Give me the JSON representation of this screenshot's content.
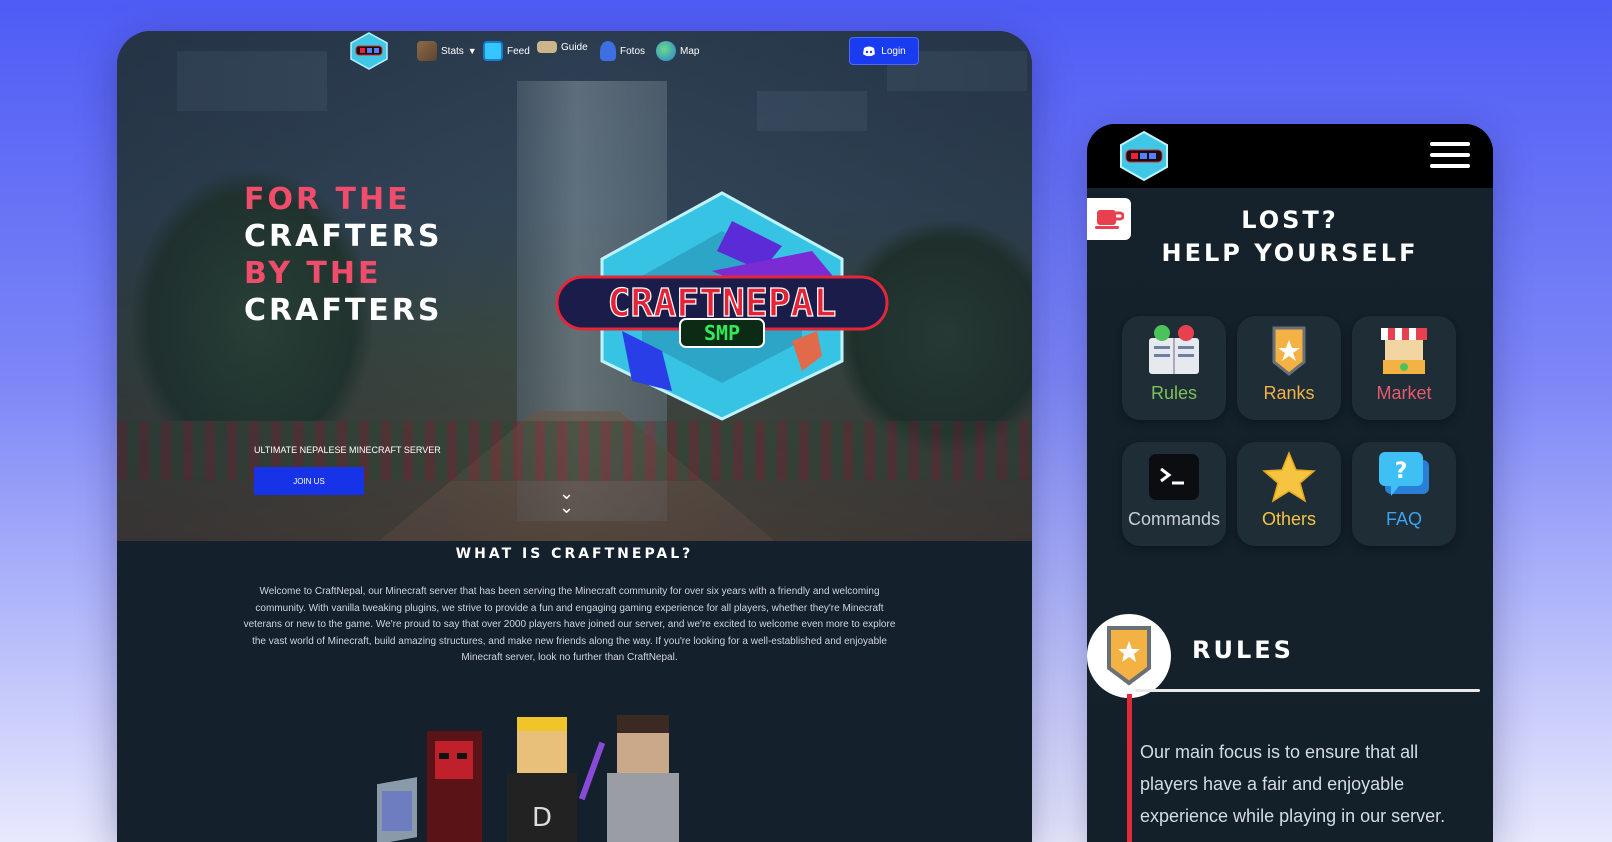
{
  "desktop": {
    "nav": {
      "items": [
        {
          "label": "Stats",
          "icon": "pickaxe-icon",
          "color": "#8c6a46"
        },
        {
          "label": "Feed",
          "icon": "feed-icon",
          "color": "#34c6ff"
        },
        {
          "label": "Guide",
          "icon": "book-icon",
          "color": "#cdb58a"
        },
        {
          "label": "Fotos",
          "icon": "camera-icon",
          "color": "#3d6fe0"
        },
        {
          "label": "Map",
          "icon": "globe-icon",
          "color": "#4cc46a"
        }
      ],
      "login_label": "Login"
    },
    "hero": {
      "title_lines": [
        "FOR THE",
        "CRAFTERS",
        "BY THE",
        "CRAFTERS"
      ],
      "tagline": "ULTIMATE NEPALESE MINECRAFT SERVER",
      "join_label": "JOIN US",
      "logo_text": "CRAFTNEPAL",
      "logo_badge": "SMP"
    },
    "about": {
      "title": "WHAT IS CRAFTNEPAL?",
      "text": "Welcome to CraftNepal, our Minecraft server that has been serving the Minecraft community for over six years with a friendly and welcoming community. With vanilla tweaking plugins, we strive to provide a fun and engaging gaming experience for all players, whether they're Minecraft veterans or new to the game. We're proud to say that over 2000 players have joined our server, and we're excited to welcome even more to explore the vast world of Minecraft, build amazing structures, and make new friends along the way. If you're looking for a well-established and enjoyable Minecraft server, look no further than CraftNepal."
    }
  },
  "mobile": {
    "title_line1": "LOST?",
    "title_line2": "HELP YOURSELF",
    "tiles": [
      {
        "label": "Rules",
        "color": "#7ec05a",
        "icon": "rules-book-icon"
      },
      {
        "label": "Ranks",
        "color": "#f3b243",
        "icon": "rank-badge-icon"
      },
      {
        "label": "Market",
        "color": "#e65a6c",
        "icon": "market-stall-icon"
      },
      {
        "label": "Commands",
        "color": "#c9ced4",
        "icon": "terminal-icon"
      },
      {
        "label": "Others",
        "color": "#f5c542",
        "icon": "star-icon"
      },
      {
        "label": "FAQ",
        "color": "#3ba3f0",
        "icon": "faq-bubble-icon"
      }
    ],
    "rules": {
      "heading": "RULES",
      "text": "Our main focus is to ensure that all players have a fair and enjoyable experience while playing in our server."
    }
  },
  "colors": {
    "accent_pink": "#ef4d6b",
    "button_blue": "#1633e8",
    "rules_line": "#e02a3a"
  }
}
